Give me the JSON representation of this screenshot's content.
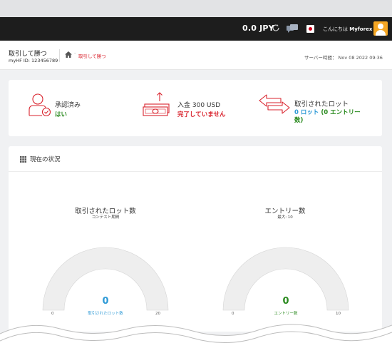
{
  "topbar": {
    "balance": "0.0 JPY",
    "greeting_prefix": "こんにちは",
    "username": "Myforex"
  },
  "subheader": {
    "page_title": "取引して勝つ",
    "account_id": "myHF ID: 123456789",
    "breadcrumb_sep": "·",
    "breadcrumb_current": "取引して勝つ",
    "server_time": "サーバー時間： Nov 08 2022 09:36"
  },
  "stats": {
    "approval": {
      "label": "承認済み",
      "value": "はい"
    },
    "deposit": {
      "label": "入金 300 USD",
      "value": "完了していません"
    },
    "lots": {
      "label": "取引されたロット",
      "value_line1_a": "0 ロット",
      "value_line1_b": "(0 エントリー",
      "value_line2": "数)"
    }
  },
  "status": {
    "title": "現在の状況",
    "gauges": [
      {
        "title": "取引されたロット数",
        "subtitle": "コンテスト期間",
        "value": "0",
        "caption": "取引されたロット数",
        "min": "0",
        "max": "20",
        "fraction": 0
      },
      {
        "title": "エントリー数",
        "subtitle": "最大: 10",
        "value": "0",
        "caption": "エントリー数",
        "min": "0",
        "max": "10",
        "fraction": 0
      }
    ]
  },
  "colors": {
    "accent_red": "#d9232d",
    "green": "#2a8a1f",
    "blue": "#2e9ad6",
    "gauge_bg": "#eeeeee"
  },
  "icons": [
    "refresh-icon",
    "chat-icon",
    "flag-icon",
    "avatar",
    "home-icon",
    "user-check-icon",
    "money-upload-icon",
    "exchange-arrows-icon",
    "grid-icon"
  ]
}
